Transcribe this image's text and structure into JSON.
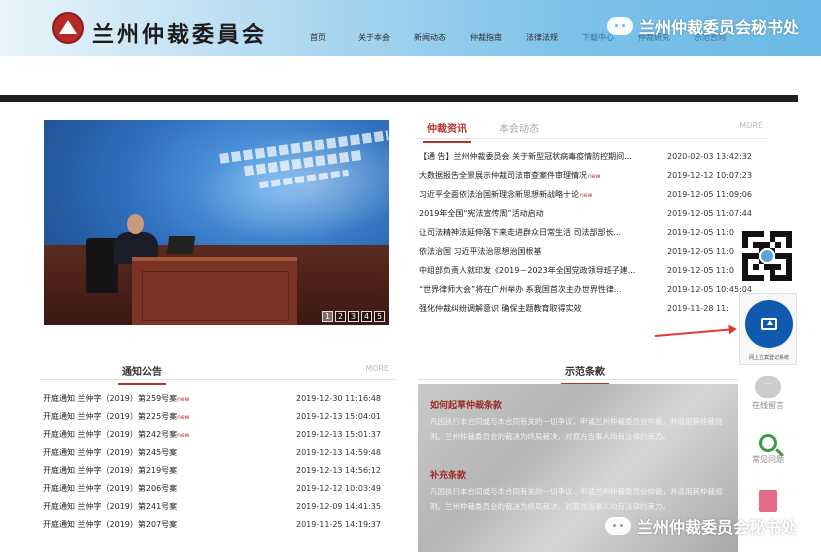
{
  "header": {
    "site_name": "兰州仲裁委員会",
    "nav": [
      "首页",
      "关于本会",
      "新闻动态",
      "仲裁指南",
      "法律法规",
      "下载中心",
      "仲裁研究",
      "示范合同"
    ]
  },
  "watermark": {
    "text": "兰州仲裁委员会秘书处"
  },
  "slideshow": {
    "pages": [
      "1",
      "2",
      "3",
      "4",
      "5"
    ],
    "active_page": "1"
  },
  "news": {
    "tab_active": "仲裁资讯",
    "tab_inactive": "本会动态",
    "more": "MORE",
    "new_mark": "new",
    "items": [
      {
        "title": "【通 告】兰州仲裁委员会 关于新型冠状病毒疫情防控期间...",
        "date": "2020-02-03 13:42:32",
        "new": false
      },
      {
        "title": "大数据报告全景展示仲裁司法审查案件审理情况",
        "date": "2019-12-12 10:07:23",
        "new": true
      },
      {
        "title": "习近平全面依法治国新理念新思想新战略十论",
        "date": "2019-12-05 11:09:06",
        "new": true
      },
      {
        "title": "2019年全国“宪法宣传周”活动启动",
        "date": "2019-12-05 11:07:44",
        "new": false
      },
      {
        "title": "让司法精神法延伸落下来走进群众日常生活 司法部部长...",
        "date": "2019-12-05 11:0",
        "new": false
      },
      {
        "title": "依法治国 习近平法治思想治国根基",
        "date": "2019-12-05 11:0",
        "new": false
      },
      {
        "title": "中组部负责人就印发《2019－2023年全国党政领导班子建...",
        "date": "2019-12-05 11:0",
        "new": false
      },
      {
        "title": "“世界律师大会”将在广州举办 系我国首次主办世界性律...",
        "date": "2019-12-05 10:45:04",
        "new": false
      },
      {
        "title": "强化仲裁纠纷调解意识 确保主题教育取得实效",
        "date": "2019-11-28 11:",
        "new": false
      }
    ]
  },
  "float_widget": {
    "label": "网上立案登记系统"
  },
  "side_tools": [
    {
      "label": "在线留言"
    },
    {
      "label": "常见问题"
    }
  ],
  "notices": {
    "title": "通知公告",
    "more": "MORE",
    "new_mark": "new",
    "items": [
      {
        "title": "开庭通知 兰仲字（2019）第259号案",
        "date": "2019-12-30 11:16:48",
        "new": true
      },
      {
        "title": "开庭通知 兰仲字（2019）第225号案",
        "date": "2019-12-13 15:04:01",
        "new": true
      },
      {
        "title": "开庭通知 兰仲字（2019）第242号案",
        "date": "2019-12-13 15:01:37",
        "new": true
      },
      {
        "title": "开庭通知 兰仲字（2019）第245号案",
        "date": "2019-12-13 14:59:48",
        "new": false
      },
      {
        "title": "开庭通知 兰仲字（2019）第219号案",
        "date": "2019-12-13 14:56:12",
        "new": false
      },
      {
        "title": "开庭通知 兰仲字（2019）第206号案",
        "date": "2019-12-12 10:03:49",
        "new": false
      },
      {
        "title": "开庭通知 兰仲字（2019）第241号案",
        "date": "2019-12-09 14:41:35",
        "new": false
      },
      {
        "title": "开庭通知 兰仲字（2019）第207号案",
        "date": "2019-11-25 14:19:37",
        "new": false
      }
    ]
  },
  "clauses": {
    "title": "示范条款",
    "items": [
      {
        "heading": "如何起草仲裁条款",
        "text": "凡因执行本合同或与本合同有关的一切争议，申请兰州仲裁委员会仲裁，并适用其仲裁规则。兰州仲裁委员会的裁决为终局裁决，对双方当事人均有法律约束力。"
      },
      {
        "heading": "补充条款",
        "text": "凡因执行本合同或与本合同有关的一切争议，申请兰州仲裁委员会仲裁，并适用其仲裁规则。兰州仲裁委员会的裁决为终局裁决，对双方当事人均有法律约束力。"
      }
    ]
  }
}
